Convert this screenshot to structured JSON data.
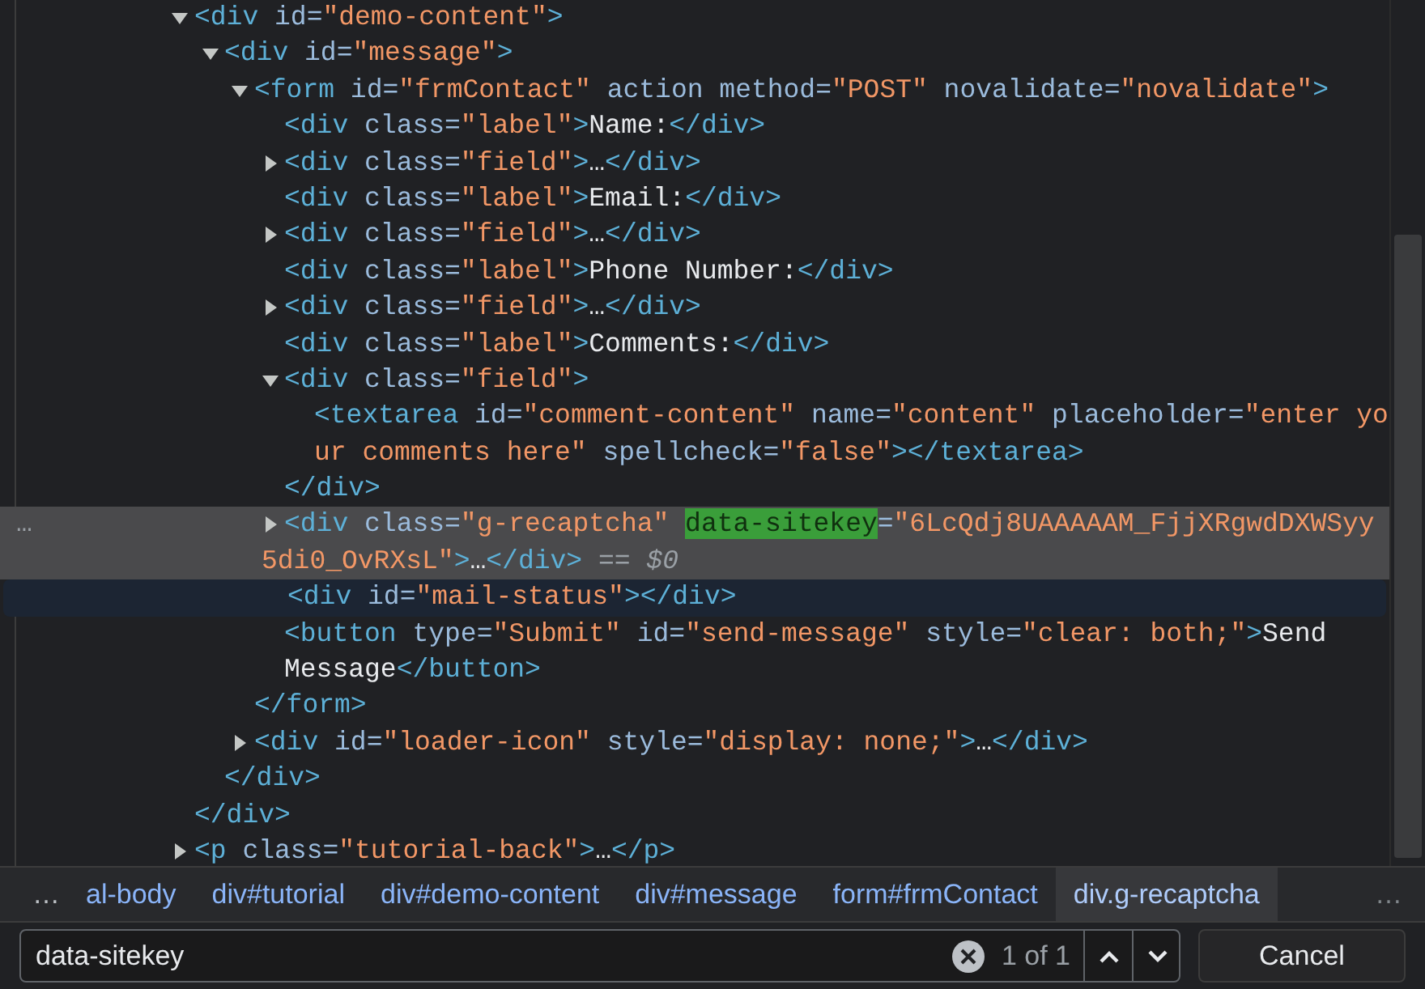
{
  "tree": [
    {
      "expanded": true,
      "selected": false,
      "hovered": false,
      "lines": [
        [
          {
            "kind": "tag",
            "text": "<div"
          },
          {
            "kind": "attr",
            "text": " id="
          },
          {
            "kind": "value",
            "text": "\"demo-content\""
          },
          {
            "kind": "tag",
            "text": ">"
          }
        ]
      ],
      "children": [
        {
          "expanded": true,
          "selected": false,
          "hovered": false,
          "lines": [
            [
              {
                "kind": "tag",
                "text": "<div"
              },
              {
                "kind": "attr",
                "text": " id="
              },
              {
                "kind": "value",
                "text": "\"message\""
              },
              {
                "kind": "tag",
                "text": ">"
              }
            ]
          ],
          "children": [
            {
              "expanded": true,
              "selected": false,
              "hovered": false,
              "lines": [
                [
                  {
                    "kind": "tag",
                    "text": "<form"
                  },
                  {
                    "kind": "attr",
                    "text": " id="
                  },
                  {
                    "kind": "value",
                    "text": "\"frmContact\""
                  },
                  {
                    "kind": "attr",
                    "text": " action method="
                  },
                  {
                    "kind": "value",
                    "text": "\"POST\""
                  },
                  {
                    "kind": "attr",
                    "text": " novalidate="
                  },
                  {
                    "kind": "value",
                    "text": "\"novalidate\""
                  },
                  {
                    "kind": "tag",
                    "text": ">"
                  }
                ]
              ],
              "children": [
                {
                  "selected": false,
                  "hovered": false,
                  "lines": [
                    [
                      {
                        "kind": "tag",
                        "text": "<div"
                      },
                      {
                        "kind": "attr",
                        "text": " class="
                      },
                      {
                        "kind": "value",
                        "text": "\"label\""
                      },
                      {
                        "kind": "tag",
                        "text": ">"
                      },
                      {
                        "kind": "text",
                        "text": "Name:"
                      },
                      {
                        "kind": "tag",
                        "text": "</div>"
                      }
                    ]
                  ]
                },
                {
                  "expanded": false,
                  "selected": false,
                  "hovered": false,
                  "lines": [
                    [
                      {
                        "kind": "tag",
                        "text": "<div"
                      },
                      {
                        "kind": "attr",
                        "text": " class="
                      },
                      {
                        "kind": "value",
                        "text": "\"field\""
                      },
                      {
                        "kind": "tag",
                        "text": ">"
                      },
                      {
                        "kind": "text",
                        "text": "…"
                      },
                      {
                        "kind": "tag",
                        "text": "</div>"
                      }
                    ]
                  ]
                },
                {
                  "selected": false,
                  "hovered": false,
                  "lines": [
                    [
                      {
                        "kind": "tag",
                        "text": "<div"
                      },
                      {
                        "kind": "attr",
                        "text": " class="
                      },
                      {
                        "kind": "value",
                        "text": "\"label\""
                      },
                      {
                        "kind": "tag",
                        "text": ">"
                      },
                      {
                        "kind": "text",
                        "text": "Email:"
                      },
                      {
                        "kind": "tag",
                        "text": "</div>"
                      }
                    ]
                  ]
                },
                {
                  "expanded": false,
                  "selected": false,
                  "hovered": false,
                  "lines": [
                    [
                      {
                        "kind": "tag",
                        "text": "<div"
                      },
                      {
                        "kind": "attr",
                        "text": " class="
                      },
                      {
                        "kind": "value",
                        "text": "\"field\""
                      },
                      {
                        "kind": "tag",
                        "text": ">"
                      },
                      {
                        "kind": "text",
                        "text": "…"
                      },
                      {
                        "kind": "tag",
                        "text": "</div>"
                      }
                    ]
                  ]
                },
                {
                  "selected": false,
                  "hovered": false,
                  "lines": [
                    [
                      {
                        "kind": "tag",
                        "text": "<div"
                      },
                      {
                        "kind": "attr",
                        "text": " class="
                      },
                      {
                        "kind": "value",
                        "text": "\"label\""
                      },
                      {
                        "kind": "tag",
                        "text": ">"
                      },
                      {
                        "kind": "text",
                        "text": "Phone Number:"
                      },
                      {
                        "kind": "tag",
                        "text": "</div>"
                      }
                    ]
                  ]
                },
                {
                  "expanded": false,
                  "selected": false,
                  "hovered": false,
                  "lines": [
                    [
                      {
                        "kind": "tag",
                        "text": "<div"
                      },
                      {
                        "kind": "attr",
                        "text": " class="
                      },
                      {
                        "kind": "value",
                        "text": "\"field\""
                      },
                      {
                        "kind": "tag",
                        "text": ">"
                      },
                      {
                        "kind": "text",
                        "text": "…"
                      },
                      {
                        "kind": "tag",
                        "text": "</div>"
                      }
                    ]
                  ]
                },
                {
                  "selected": false,
                  "hovered": false,
                  "lines": [
                    [
                      {
                        "kind": "tag",
                        "text": "<div"
                      },
                      {
                        "kind": "attr",
                        "text": " class="
                      },
                      {
                        "kind": "value",
                        "text": "\"label\""
                      },
                      {
                        "kind": "tag",
                        "text": ">"
                      },
                      {
                        "kind": "text",
                        "text": "Comments:"
                      },
                      {
                        "kind": "tag",
                        "text": "</div>"
                      }
                    ]
                  ]
                },
                {
                  "expanded": true,
                  "selected": false,
                  "hovered": false,
                  "lines": [
                    [
                      {
                        "kind": "tag",
                        "text": "<div"
                      },
                      {
                        "kind": "attr",
                        "text": " class="
                      },
                      {
                        "kind": "value",
                        "text": "\"field\""
                      },
                      {
                        "kind": "tag",
                        "text": ">"
                      }
                    ]
                  ],
                  "children": [
                    {
                      "selected": false,
                      "hovered": false,
                      "lines": [
                        [
                          {
                            "kind": "tag",
                            "text": "<textarea"
                          },
                          {
                            "kind": "attr",
                            "text": " id="
                          },
                          {
                            "kind": "value",
                            "text": "\"comment-content\""
                          },
                          {
                            "kind": "attr",
                            "text": " name="
                          },
                          {
                            "kind": "value",
                            "text": "\"content\""
                          },
                          {
                            "kind": "attr",
                            "text": " placeholder="
                          },
                          {
                            "kind": "value",
                            "text": "\"enter yo"
                          }
                        ],
                        [
                          {
                            "kind": "value",
                            "text": "ur comments here\""
                          },
                          {
                            "kind": "attr",
                            "text": " spellcheck="
                          },
                          {
                            "kind": "value",
                            "text": "\"false\""
                          },
                          {
                            "kind": "tag",
                            "text": "></textarea>"
                          }
                        ]
                      ]
                    }
                  ],
                  "close": [
                    {
                      "kind": "tag",
                      "text": "</div>"
                    }
                  ]
                },
                {
                  "expanded": false,
                  "selected": true,
                  "hovered": false,
                  "gutter": "…",
                  "lines": [
                    [
                      {
                        "kind": "tag",
                        "text": "<div"
                      },
                      {
                        "kind": "attr",
                        "text": " class="
                      },
                      {
                        "kind": "value",
                        "text": "\"g-recaptcha\" "
                      },
                      {
                        "kind": "match",
                        "text": "data-sitekey"
                      },
                      {
                        "kind": "attr",
                        "text": "="
                      },
                      {
                        "kind": "value",
                        "text": "\"6LcQdj8UAAAAAM_FjjXRgwdDXWSyy"
                      }
                    ],
                    [
                      {
                        "kind": "value",
                        "text": "5di0_OvRXsL\""
                      },
                      {
                        "kind": "tag",
                        "text": ">"
                      },
                      {
                        "kind": "text",
                        "text": "…"
                      },
                      {
                        "kind": "tag",
                        "text": "</div>"
                      },
                      {
                        "kind": "hint",
                        "text": " == $0"
                      }
                    ]
                  ]
                },
                {
                  "selected": false,
                  "hovered": true,
                  "lines": [
                    [
                      {
                        "kind": "tag",
                        "text": "<div"
                      },
                      {
                        "kind": "attr",
                        "text": " id="
                      },
                      {
                        "kind": "value",
                        "text": "\"mail-status\""
                      },
                      {
                        "kind": "tag",
                        "text": "></div>"
                      }
                    ]
                  ]
                },
                {
                  "selected": false,
                  "hovered": false,
                  "lines": [
                    [
                      {
                        "kind": "tag",
                        "text": "<button"
                      },
                      {
                        "kind": "attr",
                        "text": " type="
                      },
                      {
                        "kind": "value",
                        "text": "\"Submit\""
                      },
                      {
                        "kind": "attr",
                        "text": " id="
                      },
                      {
                        "kind": "value",
                        "text": "\"send-message\""
                      },
                      {
                        "kind": "attr",
                        "text": " style="
                      },
                      {
                        "kind": "value",
                        "text": "\"clear: both;\""
                      },
                      {
                        "kind": "tag",
                        "text": ">"
                      },
                      {
                        "kind": "text",
                        "text": "Send"
                      }
                    ],
                    [
                      {
                        "kind": "text",
                        "text": "Message"
                      },
                      {
                        "kind": "tag",
                        "text": "</button>"
                      }
                    ]
                  ]
                }
              ],
              "close": [
                {
                  "kind": "tag",
                  "text": "</form>"
                }
              ]
            },
            {
              "expanded": false,
              "selected": false,
              "hovered": false,
              "lines": [
                [
                  {
                    "kind": "tag",
                    "text": "<div"
                  },
                  {
                    "kind": "attr",
                    "text": " id="
                  },
                  {
                    "kind": "value",
                    "text": "\"loader-icon\""
                  },
                  {
                    "kind": "attr",
                    "text": " style="
                  },
                  {
                    "kind": "value",
                    "text": "\"display: none;\""
                  },
                  {
                    "kind": "tag",
                    "text": ">"
                  },
                  {
                    "kind": "text",
                    "text": "…"
                  },
                  {
                    "kind": "tag",
                    "text": "</div>"
                  }
                ]
              ]
            }
          ],
          "close": [
            {
              "kind": "tag",
              "text": "</div>"
            }
          ]
        }
      ],
      "close": [
        {
          "kind": "tag",
          "text": "</div>"
        }
      ]
    },
    {
      "expanded": false,
      "selected": false,
      "hovered": false,
      "lines": [
        [
          {
            "kind": "tag",
            "text": "<p"
          },
          {
            "kind": "attr",
            "text": " class="
          },
          {
            "kind": "value",
            "text": "\"tutorial-back\""
          },
          {
            "kind": "tag",
            "text": ">"
          },
          {
            "kind": "text",
            "text": "…"
          },
          {
            "kind": "tag",
            "text": "</p>"
          }
        ]
      ]
    }
  ],
  "breadcrumbs": {
    "more_left": "…",
    "more_right": "…",
    "items": [
      {
        "text": "al-body",
        "selected": false
      },
      {
        "text": "div#tutorial",
        "selected": false
      },
      {
        "text": "div#demo-content",
        "selected": false
      },
      {
        "text": "div#message",
        "selected": false
      },
      {
        "text": "form#frmContact",
        "selected": false
      },
      {
        "text": "div.g-recaptcha",
        "selected": true
      }
    ]
  },
  "search": {
    "value": "data-sitekey",
    "count": "1 of 1",
    "cancel": "Cancel"
  }
}
